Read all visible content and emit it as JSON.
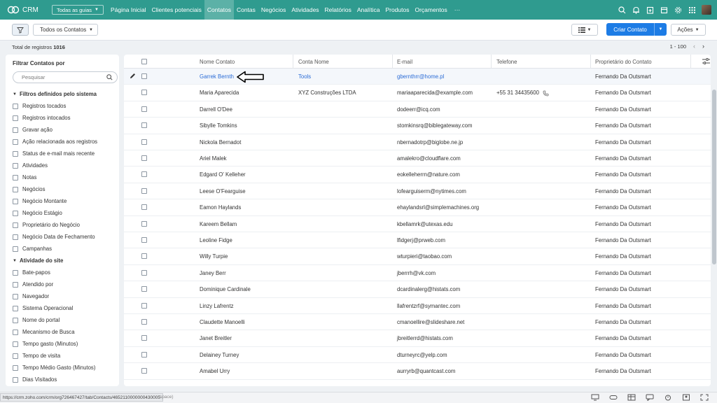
{
  "nav": {
    "brand": "CRM",
    "guides_label": "Todas as guias",
    "items": [
      {
        "label": "Página Inicial",
        "active": false
      },
      {
        "label": "Clientes potenciais",
        "active": false
      },
      {
        "label": "Contatos",
        "active": true
      },
      {
        "label": "Contas",
        "active": false
      },
      {
        "label": "Negócios",
        "active": false
      },
      {
        "label": "Atividades",
        "active": false
      },
      {
        "label": "Relatórios",
        "active": false
      },
      {
        "label": "Analítica",
        "active": false
      },
      {
        "label": "Produtos",
        "active": false
      },
      {
        "label": "Orçamentos",
        "active": false
      }
    ],
    "more": "···"
  },
  "toolbar": {
    "view_label": "Todos os Contatos",
    "create_label": "Criar Contato",
    "actions_label": "Ações"
  },
  "summary": {
    "total_label": "Total de registros",
    "total_count": "1016",
    "range": "1 - 100"
  },
  "filters": {
    "title": "Filtrar Contatos por",
    "search_placeholder": "Pesquisar",
    "sections": [
      {
        "title": "Filtros definidos pelo sistema",
        "items": [
          "Registros tocados",
          "Registros intocados",
          "Gravar ação",
          "Ação relacionada aos registros",
          "Status de e-mail mais recente",
          "Atividades",
          "Notas",
          "Negócios",
          "Negócio Montante",
          "Negócio Estágio",
          "Proprietário do Negócio",
          "Negócio Data de Fechamento",
          "Campanhas"
        ]
      },
      {
        "title": "Atividade do site",
        "items": [
          "Bate-papos",
          "Atendido por",
          "Navegador",
          "Sistema Operacional",
          "Nome do portal",
          "Mecanismo de Busca",
          "Tempo gasto (Minutos)",
          "Tempo de visita",
          "Tempo Médio Gasto (Minutos)",
          "Dias Visitados"
        ]
      }
    ]
  },
  "table": {
    "columns": [
      "Nome Contato",
      "Conta Nome",
      "E-mail",
      "Telefone",
      "Proprietário do Contato"
    ],
    "rows": [
      {
        "name": "Garrek Bernth",
        "account": "Tools",
        "email": "gbernthrr@home.pl",
        "phone": "",
        "owner": "Fernando Da Outsmart"
      },
      {
        "name": "Maria Aparecida",
        "account": "XYZ Construções LTDA",
        "email": "mariaaparecida@example.com",
        "phone": "+55 31 34435600",
        "owner": "Fernando Da Outsmart"
      },
      {
        "name": "Darrell O'Dee",
        "account": "",
        "email": "dodeerr@icq.com",
        "phone": "",
        "owner": "Fernando Da Outsmart"
      },
      {
        "name": "Sibylle Tomkins",
        "account": "",
        "email": "stomkinsrq@biblegateway.com",
        "phone": "",
        "owner": "Fernando Da Outsmart"
      },
      {
        "name": "Nickola Bernadot",
        "account": "",
        "email": "nbernadotrp@biglobe.ne.jp",
        "phone": "",
        "owner": "Fernando Da Outsmart"
      },
      {
        "name": "Ariel Malek",
        "account": "",
        "email": "amalekro@cloudflare.com",
        "phone": "",
        "owner": "Fernando Da Outsmart"
      },
      {
        "name": "Edgard O' Kelleher",
        "account": "",
        "email": "eokelleherrn@nature.com",
        "phone": "",
        "owner": "Fernando Da Outsmart"
      },
      {
        "name": "Leese O'Fearguise",
        "account": "",
        "email": "lofearguiserm@nytimes.com",
        "phone": "",
        "owner": "Fernando Da Outsmart"
      },
      {
        "name": "Eamon Haylands",
        "account": "",
        "email": "ehaylandsrl@simplemachines.org",
        "phone": "",
        "owner": "Fernando Da Outsmart"
      },
      {
        "name": "Kareem Bellam",
        "account": "",
        "email": "kbellamrk@utexas.edu",
        "phone": "",
        "owner": "Fernando Da Outsmart"
      },
      {
        "name": "Leoline Fidge",
        "account": "",
        "email": "lfidgerj@prweb.com",
        "phone": "",
        "owner": "Fernando Da Outsmart"
      },
      {
        "name": "Willy Turpie",
        "account": "",
        "email": "wturpieri@taobao.com",
        "phone": "",
        "owner": "Fernando Da Outsmart"
      },
      {
        "name": "Janey Berr",
        "account": "",
        "email": "jberrrh@vk.com",
        "phone": "",
        "owner": "Fernando Da Outsmart"
      },
      {
        "name": "Dominique Cardinale",
        "account": "",
        "email": "dcardinalerg@histats.com",
        "phone": "",
        "owner": "Fernando Da Outsmart"
      },
      {
        "name": "Linzy Lafrentz",
        "account": "",
        "email": "llafrentzrf@symantec.com",
        "phone": "",
        "owner": "Fernando Da Outsmart"
      },
      {
        "name": "Claudette Manoelli",
        "account": "",
        "email": "cmanoellire@slideshare.net",
        "phone": "",
        "owner": "Fernando Da Outsmart"
      },
      {
        "name": "Janet Breitler",
        "account": "",
        "email": "jbreitlerrd@histats.com",
        "phone": "",
        "owner": "Fernando Da Outsmart"
      },
      {
        "name": "Delainey Turney",
        "account": "",
        "email": "dturneyrc@yelp.com",
        "phone": "",
        "owner": "Fernando Da Outsmart"
      },
      {
        "name": "Amabel Urry",
        "account": "",
        "email": "aurryrb@quantcast.com",
        "phone": "",
        "owner": "Fernando Da Outsmart"
      }
    ]
  },
  "statusbar": {
    "url": "https://crm.zoho.com/crm/org726467427/tab/Contacts/4652110000000430005",
    "url_tail": "space)"
  },
  "colors": {
    "nav_bg": "#2f9b8f",
    "primary": "#1d7ce5",
    "link": "#2b6cd6"
  }
}
